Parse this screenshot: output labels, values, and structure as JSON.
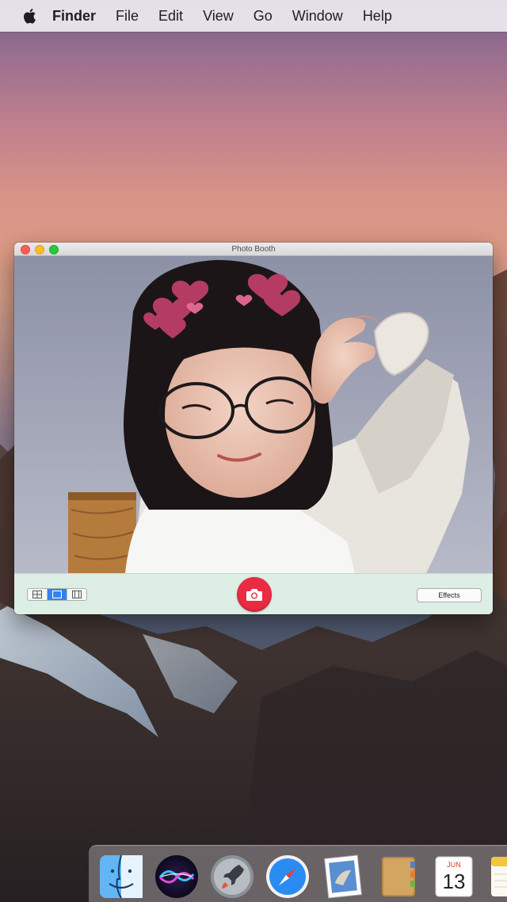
{
  "menubar": {
    "app_name": "Finder",
    "items": [
      "File",
      "Edit",
      "View",
      "Go",
      "Window",
      "Help"
    ]
  },
  "window": {
    "title": "Photo Booth",
    "effects_label": "Effects",
    "view_modes": [
      "four-up-icon",
      "single-photo-icon",
      "filmstrip-icon"
    ],
    "active_view_mode": "single-photo-icon",
    "shutter_color": "#ea2c43"
  },
  "dock": {
    "apps": [
      "finder-icon",
      "siri-icon",
      "launchpad-icon",
      "safari-icon",
      "preview-icon",
      "contacts-icon",
      "calendar-icon",
      "notes-icon"
    ],
    "calendar": {
      "month": "JUN",
      "day": "13"
    }
  }
}
